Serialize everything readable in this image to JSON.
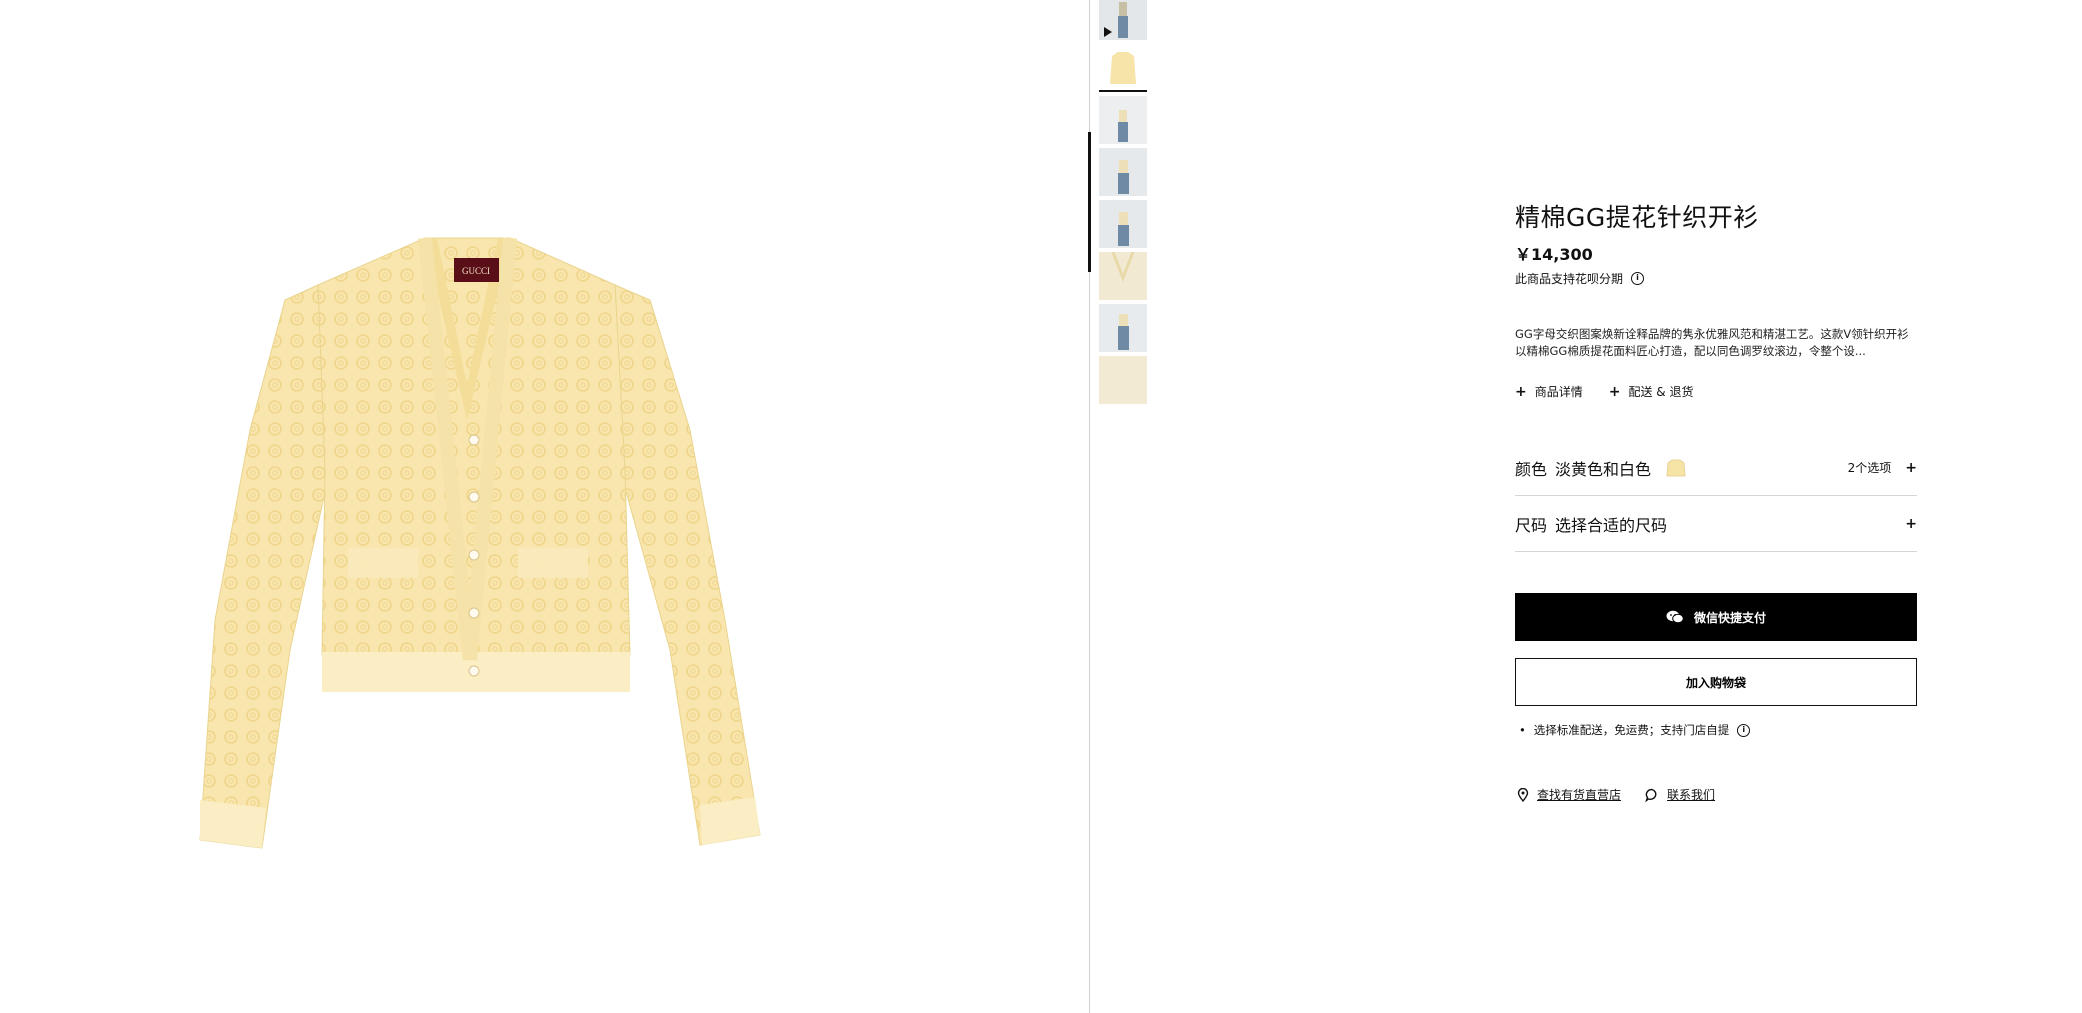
{
  "product": {
    "title": "精棉GG提花针织开衫",
    "price": "￥14,300",
    "installment_text": "此商品支持花呗分期",
    "description": "GG字母交织图案焕新诠释品牌的隽永优雅风范和精湛工艺。这款V领针织开衫以精棉GG棉质提花面料匠心打造，配以同色调罗纹滚边，令整个设...",
    "main_image": {
      "label": "GUCCI",
      "color": "#f7e4a8"
    }
  },
  "detail_links": {
    "details": "商品详情",
    "delivery": "配送 & 退货"
  },
  "color_selector": {
    "label": "颜色",
    "value": "淡黄色和白色",
    "options_count": "2个选项",
    "swatch_color": "#f6e3a6"
  },
  "size_selector": {
    "label": "尺码",
    "value": "选择合适的尺码"
  },
  "buttons": {
    "wechat_pay": "微信快捷支付",
    "add_to_bag": "加入购物袋"
  },
  "shipping_note": "选择标准配送，免运费；支持门店自提",
  "footer_links": {
    "find_store": "查找有货直营店",
    "contact": "联系我们"
  },
  "thumbnails": [
    {
      "name": "video-thumb",
      "kind": "model",
      "has_play": true
    },
    {
      "name": "product-thumb",
      "kind": "product",
      "active": true
    },
    {
      "name": "model-front",
      "kind": "model"
    },
    {
      "name": "model-side",
      "kind": "model"
    },
    {
      "name": "model-back",
      "kind": "model"
    },
    {
      "name": "detail-closeup",
      "kind": "closeup"
    },
    {
      "name": "model-full",
      "kind": "model"
    },
    {
      "name": "fabric-detail",
      "kind": "fabric"
    }
  ],
  "colors": {
    "accent": "#000000",
    "cardigan": "#f7e4a8",
    "divider": "#cfcfcf"
  }
}
